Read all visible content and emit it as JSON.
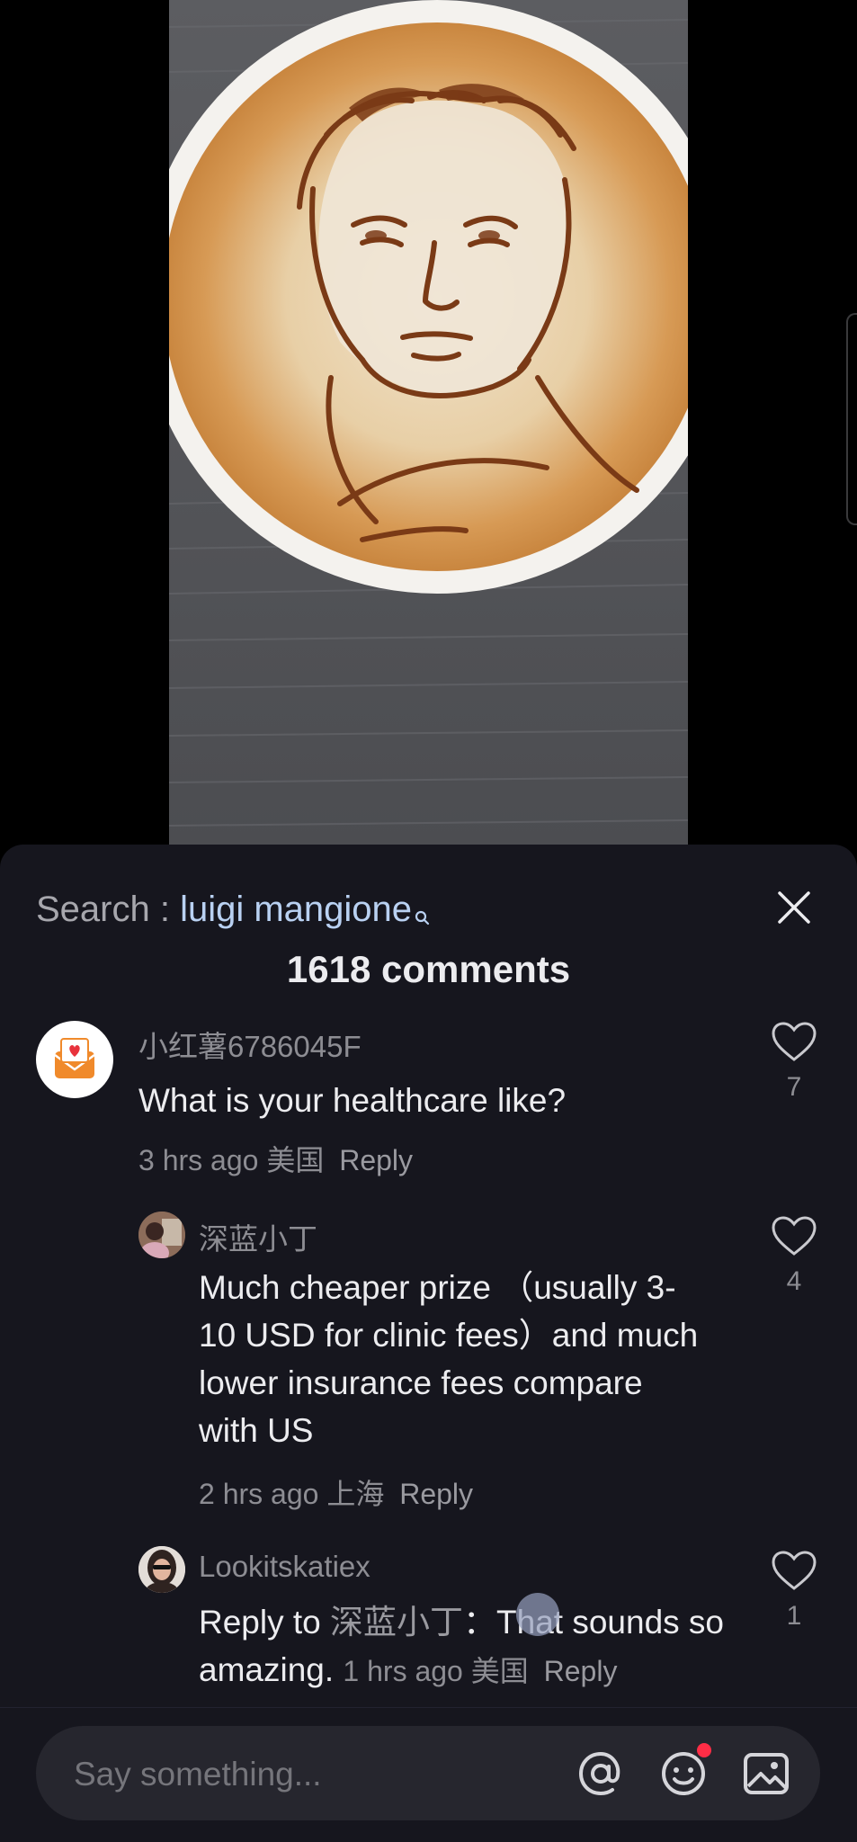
{
  "colors": {
    "sheet_bg": "#16161e",
    "search_term": "#b9d1f2",
    "text_primary": "#ececef",
    "text_secondary": "#8d8d93",
    "notification_dot": "#ff2d46"
  },
  "header": {
    "search_prefix": "Search : ",
    "search_term": "luigi mangione",
    "comment_count_label": "1618 comments"
  },
  "comments": [
    {
      "username": "小红薯6786045F",
      "avatar_icon": "envelope-heart-icon",
      "text": "What is your healthcare like?",
      "time": "3 hrs ago",
      "location": "美国",
      "reply_label": "Reply",
      "likes": "7"
    },
    {
      "username": "深蓝小丁",
      "avatar_icon": "user-photo",
      "text": "Much cheaper prize （usually 3-10 USD for clinic fees）and much lower insurance fees compare with US",
      "time": "2 hrs ago",
      "location": "上海",
      "reply_label": "Reply",
      "likes": "4"
    },
    {
      "username": "Lookitskatiex",
      "avatar_icon": "user-photo",
      "reply_prefix": "Reply to ",
      "reply_target": "深蓝小丁",
      "reply_sep": "：",
      "text": "That sounds so amazing.",
      "time": "1 hrs ago",
      "location": "美国",
      "reply_label": "Reply",
      "likes": "1"
    }
  ],
  "input_bar": {
    "placeholder": "Say something...",
    "icons": [
      "at-icon",
      "emoji-icon",
      "image-icon"
    ]
  }
}
